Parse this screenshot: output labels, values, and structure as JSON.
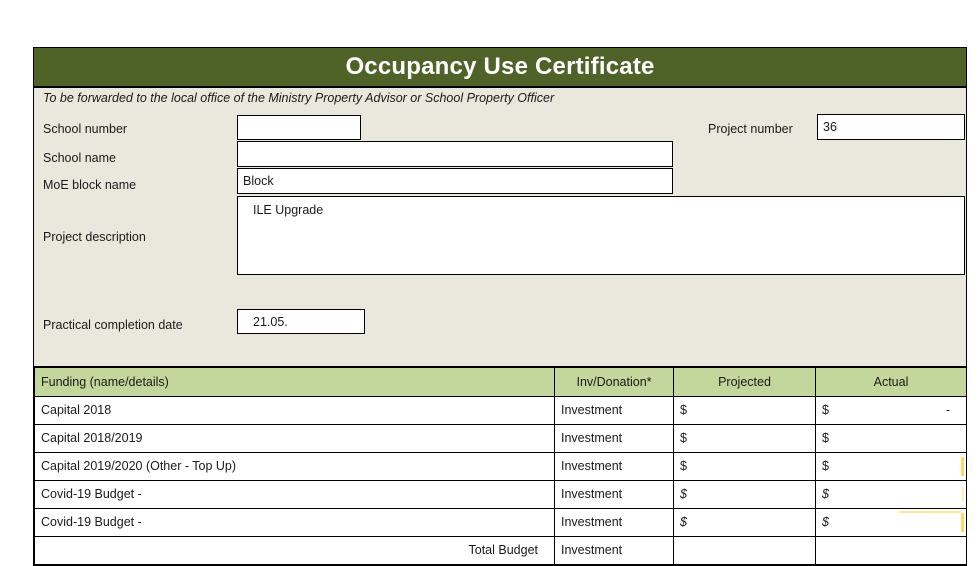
{
  "document": {
    "title": "Occupancy Use Certificate",
    "subtitle": "To be forwarded to the local office of the Ministry Property Advisor or School Property Officer"
  },
  "form": {
    "school_number": {
      "label": "School number",
      "value": ""
    },
    "school_name": {
      "label": "School name",
      "value": ""
    },
    "moe_block_name": {
      "label": "MoE block name",
      "value": "Block"
    },
    "project_number": {
      "label": "Project number",
      "value": "36"
    },
    "project_description": {
      "label": "Project description",
      "value": "ILE Upgrade"
    },
    "practical_completion_date": {
      "label": "Practical completion date",
      "value": "21.05."
    }
  },
  "funding_table": {
    "headers": {
      "name": "Funding (name/details)",
      "type": "Inv/Donation*",
      "projected": "Projected",
      "actual": "Actual"
    },
    "rows": [
      {
        "name": "Capital  2018",
        "type": "Investment",
        "projected_symbol": "$",
        "projected_value": "",
        "actual_symbol": "$",
        "actual_value": "-"
      },
      {
        "name": "Capital 2018/2019",
        "type": "Investment",
        "projected_symbol": "$",
        "projected_value": "",
        "actual_symbol": "$",
        "actual_value": ""
      },
      {
        "name": "Capital 2019/2020 (Other - Top Up)",
        "type": "Investment",
        "projected_symbol": "$",
        "projected_value": "",
        "actual_symbol": "$",
        "actual_value": ""
      },
      {
        "name": "Covid-19 Budget -",
        "type": "Investment",
        "projected_symbol": "$",
        "projected_value": "",
        "actual_symbol": "$",
        "actual_value": ""
      },
      {
        "name": "Covid-19 Budget -",
        "type": "Investment",
        "projected_symbol": "$",
        "projected_value": "",
        "actual_symbol": "$",
        "actual_value": ""
      }
    ],
    "total_row": {
      "label": "Total Budget",
      "type": "Investment",
      "projected_value": "",
      "actual_value": ""
    }
  },
  "colors": {
    "title_bar": "#4F6228",
    "table_header": "#C3D69B",
    "form_background": "#EAE8DC",
    "highlight": "#FFD966"
  }
}
